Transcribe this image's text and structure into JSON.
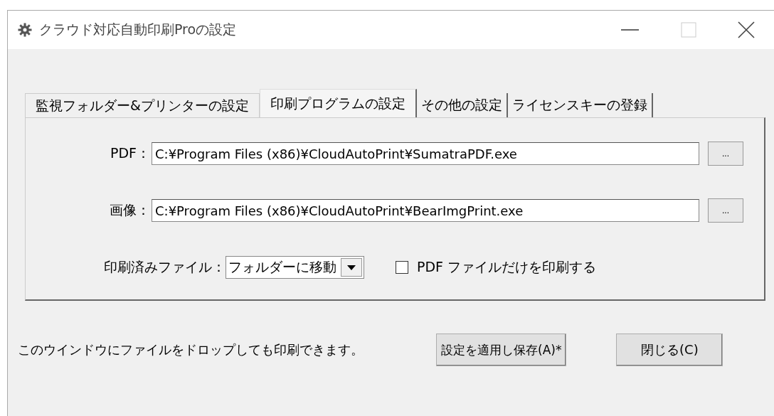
{
  "window": {
    "title": "クラウド対応自動印刷Proの設定"
  },
  "tabs": [
    {
      "label": "監視フォルダー&プリンターの設定",
      "selected": false
    },
    {
      "label": "印刷プログラムの設定",
      "selected": true
    },
    {
      "label": "その他の設定",
      "selected": false
    },
    {
      "label": "ライセンスキーの登録",
      "selected": false
    }
  ],
  "paths": [
    {
      "label": "PDF：",
      "value": "C:¥Program Files (x86)¥CloudAutoPrint¥SumatraPDF.exe",
      "button": "..."
    },
    {
      "label": "画像：",
      "value": "C:¥Program Files (x86)¥CloudAutoPrint¥BearImgPrint.exe",
      "button": "..."
    }
  ],
  "printed_files": {
    "label": "印刷済みファイル：",
    "value": "フォルダーに移動"
  },
  "pdf_only": {
    "label": "PDF ファイルだけを印刷する",
    "checked": false
  },
  "hint": "このウインドウにファイルをドロップしても印刷できます。",
  "buttons": [
    "設定を適用し保存(A)*",
    "閉じる(C)"
  ]
}
